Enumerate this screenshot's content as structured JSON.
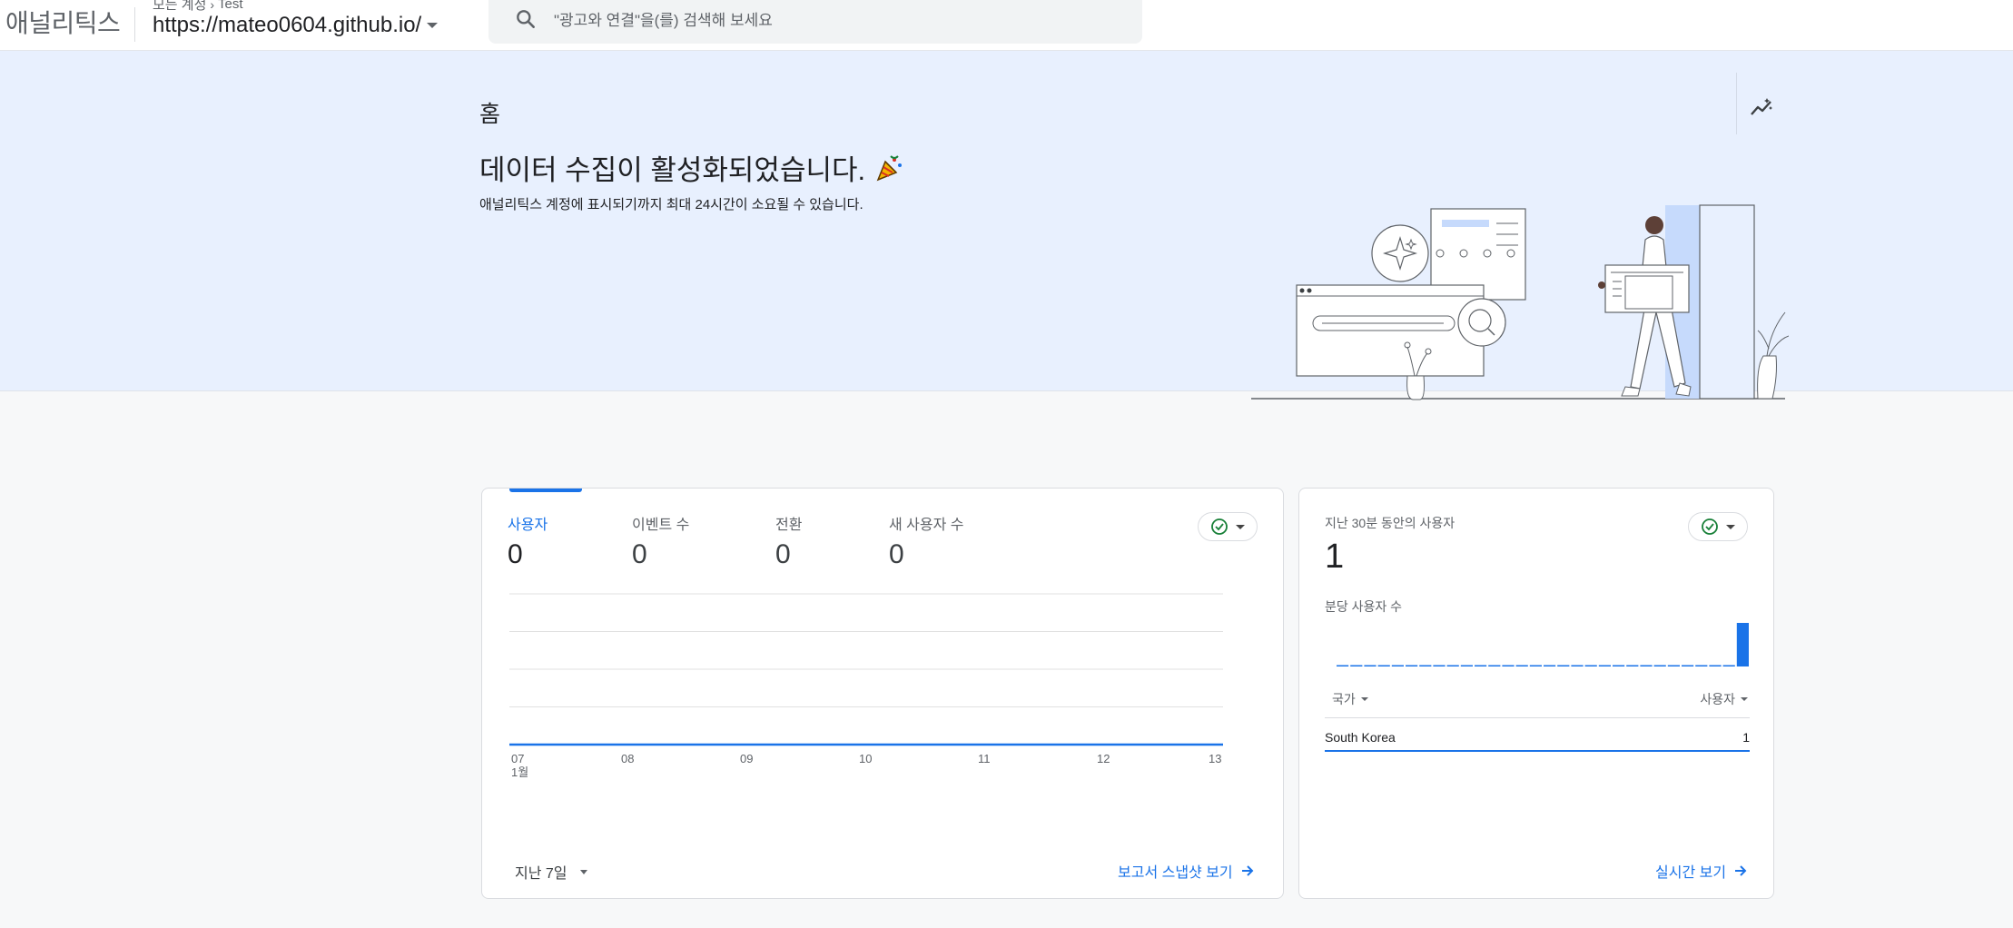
{
  "header": {
    "app_name": "애널리틱스",
    "account_crumb": "모든 계정",
    "account_name": "Test",
    "property": "https://mateo0604.github.io/",
    "search_placeholder": "\"광고와 연결\"을(를) 검색해 보세요"
  },
  "hero": {
    "title": "홈",
    "heading": "데이터 수집이 활성화되었습니다.",
    "subtext": "애널리틱스 계정에 표시되기까지 최대 24시간이 소요될 수 있습니다."
  },
  "overview": {
    "metrics": [
      {
        "label": "사용자",
        "value": "0"
      },
      {
        "label": "이벤트 수",
        "value": "0"
      },
      {
        "label": "전환",
        "value": "0"
      },
      {
        "label": "새 사용자 수",
        "value": "0"
      }
    ],
    "date_range": "지난 7일",
    "report_link": "보고서 스냅샷 보기"
  },
  "chart_data": {
    "type": "line",
    "x": [
      "07",
      "08",
      "09",
      "10",
      "11",
      "12",
      "13"
    ],
    "x_sublabel": "1월",
    "series": [
      {
        "values": [
          0,
          0,
          0,
          0,
          0,
          0,
          0
        ]
      }
    ],
    "grid": true
  },
  "realtime": {
    "label": "지난 30분 동안의 사용자",
    "value": "1",
    "per_minute_label": "분당 사용자 수",
    "per_minute_values": [
      0,
      0,
      0,
      0,
      0,
      0,
      0,
      0,
      0,
      0,
      0,
      0,
      0,
      0,
      0,
      0,
      0,
      0,
      0,
      0,
      0,
      0,
      0,
      0,
      0,
      0,
      0,
      0,
      0,
      1
    ],
    "col_country": "국가",
    "col_users": "사용자",
    "rows": [
      {
        "country": "South Korea",
        "users": "1"
      }
    ],
    "link": "실시간 보기"
  },
  "colors": {
    "accent": "#1a73e8",
    "hero_bg": "#e8f0fe",
    "status_ok": "#188038"
  }
}
